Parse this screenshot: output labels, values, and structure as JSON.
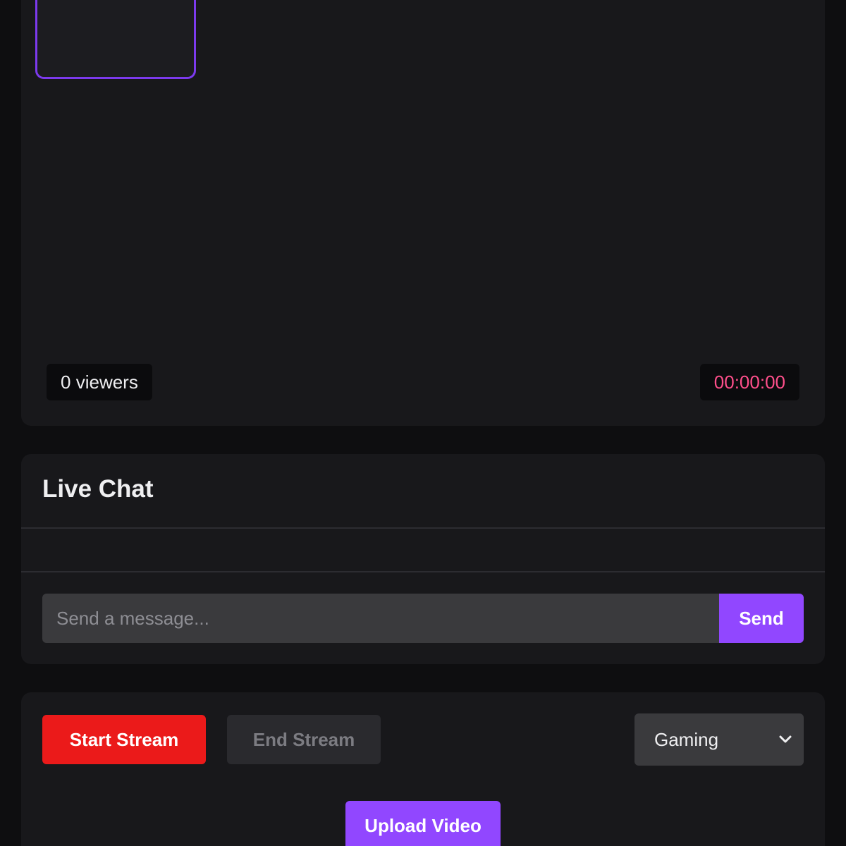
{
  "video": {
    "viewer_count": "0",
    "viewer_label": "viewers",
    "timer": "00:00:00"
  },
  "chat": {
    "title": "Live Chat",
    "input_placeholder": "Send a message...",
    "input_value": "",
    "send_label": "Send"
  },
  "controls": {
    "start_label": "Start Stream",
    "end_label": "End Stream",
    "category_selected": "Gaming",
    "upload_label": "Upload Video"
  },
  "colors": {
    "background": "#0e0e10",
    "card": "#18181b",
    "accent_purple": "#9147ff",
    "start_red": "#eb1a1a",
    "timer_pink": "#ff4f8b"
  },
  "icons": {
    "select_arrow": "chevron-down-icon"
  }
}
